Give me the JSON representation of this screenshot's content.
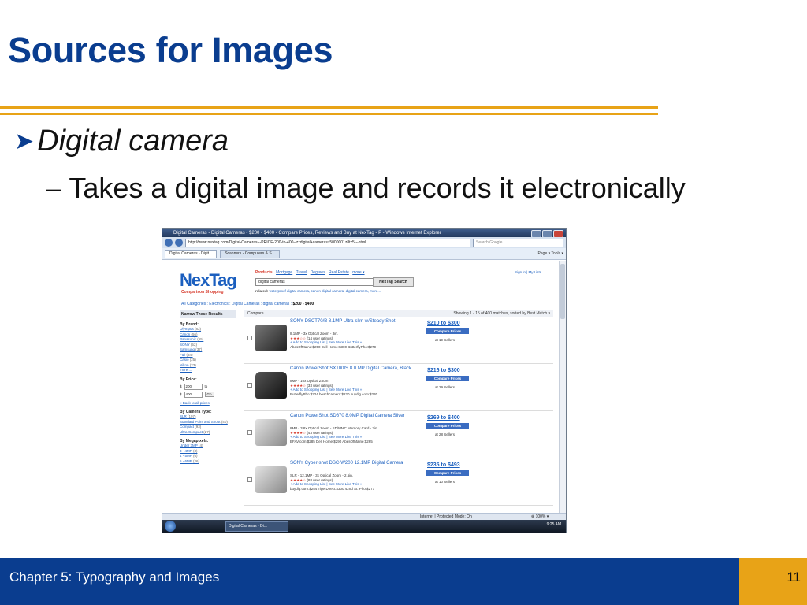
{
  "slide": {
    "title": "Sources for Images",
    "bullet": "Digital camera",
    "sub_bullet": "– Takes a digital image and records it electronically",
    "footer": "Chapter 5: Typography and Images",
    "page_number": "11"
  },
  "screenshot": {
    "window_title": "Digital Cameras - Digital Cameras - $200 - $400 - Compare Prices, Reviews and Buy at NexTag - P - Windows Internet Explorer",
    "url": "http://www.nextag.com/Digital-Cameras/--PRICE-200-to-400--zzdigital+camerasz5000001z8tz5---html",
    "search_placeholder": "Search Google",
    "tab_active": "Digital Cameras - Digit...",
    "tab_other": "Scanners - Computers & S...",
    "toolbar": "Page ▾  Tools ▾",
    "logo": "NexTag",
    "logo_sub": "Comparison Shopping",
    "products_label": "Products",
    "nav_links": [
      "Mortgage",
      "Travel",
      "Degrees",
      "Real Estate",
      "more ▾"
    ],
    "signin": "Sign in | My Lists",
    "search_value": "digital cameras",
    "search_button": "NexTag Search",
    "related": "related:",
    "related_links": "waterproof digital camera, canon digital camera, digital camera,  more...",
    "breadcrumb": "All Categories : Electronics : Digital Cameras : digital cameras :",
    "breadcrumb_current": "$200 - $400",
    "narrow_header": "Narrow These Results",
    "compare_label": "Compare",
    "showing": "Showing 1 - 15 of 400 matches, sorted by Best Match ▾",
    "brand_header": "By Brand:",
    "brands": [
      {
        "name": "Olympus",
        "count": "(83)"
      },
      {
        "name": "Canon",
        "count": "(56)"
      },
      {
        "name": "Panasonic",
        "count": "(55)"
      },
      {
        "name": "SONY",
        "count": "(52)"
      },
      {
        "name": "Samsung",
        "count": "(37)"
      },
      {
        "name": "Fuji",
        "count": "(34)"
      },
      {
        "name": "Casio",
        "count": "(25)"
      },
      {
        "name": "Nikon",
        "count": "(23)"
      },
      {
        "name": "more ...",
        "count": ""
      }
    ],
    "price_header": "By Price:",
    "price_from": "200",
    "price_to_label": "to",
    "price_to": "400",
    "go": "Go",
    "back_prices": "« Back to all prices",
    "type_header": "By Camera Type:",
    "types": [
      {
        "name": "SLR",
        "count": "(197)"
      },
      {
        "name": "Standard Point and Shoot",
        "count": "(40)"
      },
      {
        "name": "Compact",
        "count": "(93)"
      },
      {
        "name": "Ultra-Compact",
        "count": "(27)"
      }
    ],
    "mp_header": "By Megapixels:",
    "mps": [
      {
        "name": "Under 3MP",
        "count": "(4)"
      },
      {
        "name": "3 - 4MP",
        "count": "(3)"
      },
      {
        "name": "4 - 5MP",
        "count": "(6)"
      },
      {
        "name": "5 - 6MP",
        "count": "(26)"
      }
    ],
    "results": [
      {
        "title": "SONY DSCT70/B 8.1MP Ultra-slim w/Steady Shot",
        "spec": "8.1MP - 3x Optical Zoom - 3in.",
        "rating": "(14 user ratings)",
        "links": "+ Add to Shopping List | See More Like This »",
        "stores": "AbesOfMaine:$250  Dell Home:$300  ButterflyPho:$279",
        "price": "$210 to $300",
        "button": "Compare Prices",
        "sellers": "at 19 Sellers"
      },
      {
        "title": "Canon PowerShot SX100IS 8.0 MP Digital Camera, Black",
        "spec": "8MP - 10x Optical Zoom",
        "rating": "(33 user ratings)",
        "links": "+ Add to Shopping List | See More Like This »",
        "stores": "ButterflyPho:$224  beachcamera:$220  buydig.com:$230",
        "price": "$216 to $300",
        "button": "Compare Prices",
        "sellers": "at 29 Sellers"
      },
      {
        "title": "Canon PowerShot SD870 8.0MP Digital Camera Silver",
        "spec": "8MP - 3.8x Optical Zoom - SD/MMC Memory Card - 3in.",
        "rating": "(43 user ratings)",
        "links": "+ Add to Shopping List | See More Like This »",
        "stores": "BFAV.com:$285  Dell Home:$290  AbesOfMaine:$265",
        "price": "$269 to $400",
        "button": "Compare Prices",
        "sellers": "at 28 Sellers"
      },
      {
        "title": "SONY Cyber-shot DSC-W200 12.1MP Digital Camera",
        "spec": "SLR - 12.1MP - 3x Optical Zoom - 2.5in.",
        "rating": "(88 user ratings)",
        "links": "+ Add to Shopping List | See More Like This »",
        "stores": "buydig.com:$254  TigerDirect:$300  42nd St. Pho:$277",
        "price": "$235 to $493",
        "button": "Compare Prices",
        "sellers": "at 10 Sellers"
      }
    ],
    "status_zone": "Internet | Protected Mode: On",
    "zoom": "⊕ 100% ▾",
    "task": "Digital Cameras - Di...",
    "clock": "9:25 AM"
  }
}
